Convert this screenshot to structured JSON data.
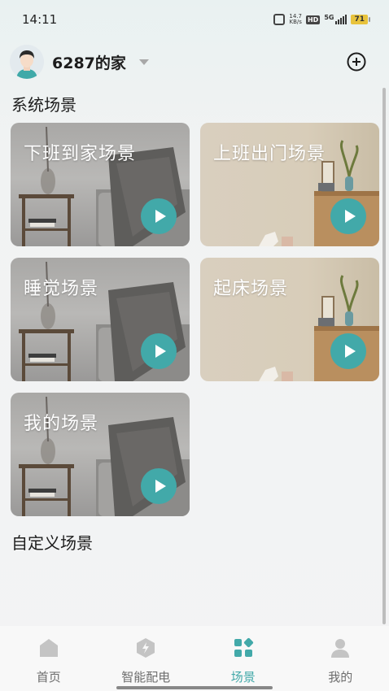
{
  "status_bar": {
    "time": "14:11",
    "net_speed": "14.7",
    "net_unit": "KB/s",
    "hd": "HD",
    "signal": "5G",
    "battery": "71"
  },
  "header": {
    "home_name": "6287的家",
    "add_icon": "plus-circle-icon",
    "dropdown_icon": "caret-down-icon"
  },
  "sections": {
    "system_title": "系统场景",
    "custom_title": "自定义场景"
  },
  "scenes": [
    {
      "label": "下班到家场景",
      "theme": "grey"
    },
    {
      "label": "上班出门场景",
      "theme": "beige"
    },
    {
      "label": "睡觉场景",
      "theme": "grey"
    },
    {
      "label": "起床场景",
      "theme": "beige"
    },
    {
      "label": "我的场景",
      "theme": "grey"
    }
  ],
  "tabs": [
    {
      "label": "首页",
      "icon": "home-icon",
      "active": false
    },
    {
      "label": "智能配电",
      "icon": "lightning-hexagon-icon",
      "active": false
    },
    {
      "label": "场景",
      "icon": "scene-grid-icon",
      "active": true
    },
    {
      "label": "我的",
      "icon": "person-icon",
      "active": false
    }
  ],
  "colors": {
    "accent": "#42a9a9",
    "tab_inactive": "#6d6d6d",
    "icon_inactive": "#c4c4c4"
  }
}
